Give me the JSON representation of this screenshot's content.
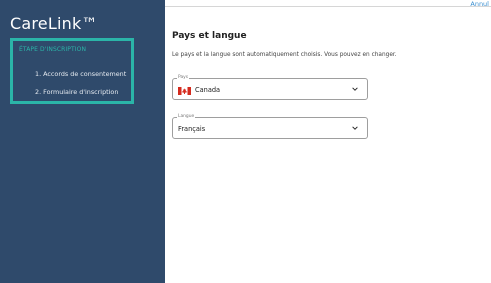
{
  "sidebar": {
    "brand": "CareLink™",
    "steps_heading": "ÉTAPE D'INSCRIPTION",
    "steps": [
      "1. Accords de consentement",
      "2. Formulaire d'inscription"
    ]
  },
  "header": {
    "cancel_label": "Annul"
  },
  "main": {
    "title": "Pays et langue",
    "description": "Le pays et la langue sont automatiquement choisis. Vous pouvez en changer.",
    "country_field": {
      "label": "Pays",
      "value": "Canada",
      "flag_icon": "canada-flag-icon"
    },
    "language_field": {
      "label": "Langue",
      "value": "Français"
    }
  },
  "colors": {
    "sidebar_bg": "#2f4a6b",
    "accent_teal": "#2bb5a8",
    "link_blue": "#3a8fd0"
  }
}
